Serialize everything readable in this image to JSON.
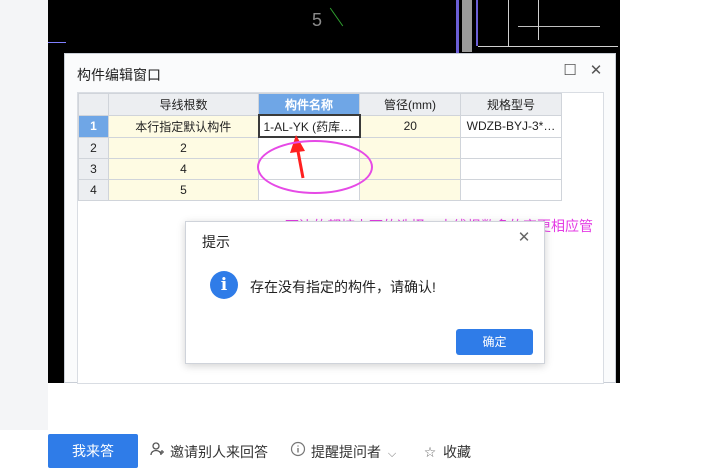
{
  "cad": {
    "label": "5"
  },
  "editor": {
    "title": "构件编辑窗口",
    "maximize_icon": "maximize-icon",
    "close_icon": "close-icon",
    "columns": [
      "导线根数",
      "构件名称",
      "管径(mm)",
      "规格型号"
    ],
    "rows": [
      {
        "num": "1",
        "wires": "本行指定默认构件",
        "name": "1-AL-YK (药库…",
        "diameter": "20",
        "model": "WDZB-BYJ-3*…"
      },
      {
        "num": "2",
        "wires": "2",
        "name": "",
        "diameter": "",
        "model": ""
      },
      {
        "num": "3",
        "wires": "4",
        "name": "",
        "diameter": "",
        "model": ""
      },
      {
        "num": "4",
        "wires": "5",
        "name": "",
        "diameter": "",
        "model": ""
      }
    ]
  },
  "annotation": {
    "note": "下边的都按上面的选择，电线根数多的变更相应管",
    "color": "#e43ce4"
  },
  "dialog": {
    "title": "提示",
    "message": "存在没有指定的构件，请确认!",
    "ok_label": "确定",
    "icon": "info-icon"
  },
  "bottom_bar": {
    "answer_label": "我来答",
    "invite_label": "邀请别人来回答",
    "remind_label": "提醒提问者",
    "favorite_label": "收藏"
  },
  "colors": {
    "accent": "#2f7ce8",
    "header_selected": "#6fa6e6",
    "cell_yellow": "#fefbe3"
  }
}
